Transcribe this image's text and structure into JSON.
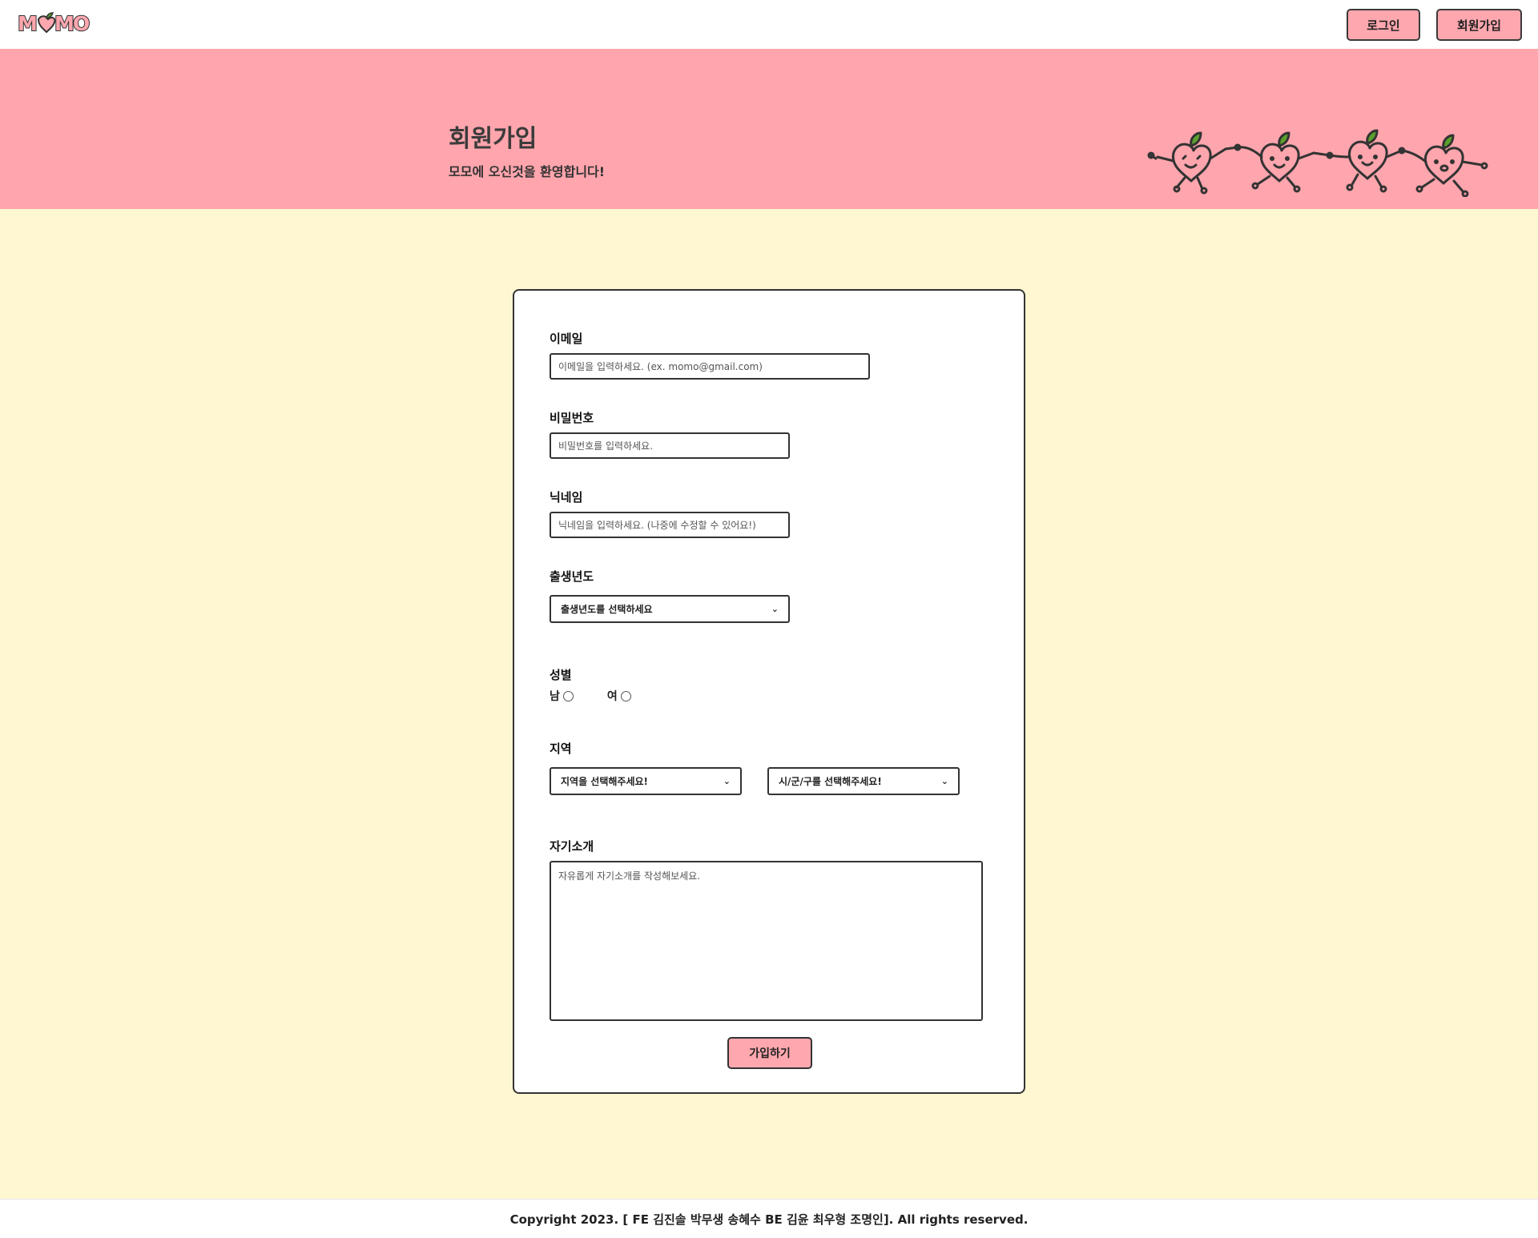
{
  "header": {
    "logo_text": "MOMO",
    "login_label": "로그인",
    "signup_label": "회원가입"
  },
  "banner": {
    "title": "회원가입",
    "subtitle": "모모에 오신것을 환영합니다!"
  },
  "form": {
    "email": {
      "label": "이메일",
      "placeholder": "이메일을 입력하세요. (ex. momo@gmail.com)"
    },
    "password": {
      "label": "비밀번호",
      "placeholder": "비밀번호를 입력하세요."
    },
    "nickname": {
      "label": "닉네임",
      "placeholder": "닉네임을 입력하세요. (나중에 수정할 수 있어요!)"
    },
    "birth_year": {
      "label": "출생년도",
      "selected": "출생년도를 선택하세요"
    },
    "gender": {
      "label": "성별",
      "options": [
        "남",
        "여"
      ]
    },
    "region": {
      "label": "지역",
      "province_selected": "지역을 선택해주세요!",
      "district_selected": "시/군/구를 선택해주세요!"
    },
    "intro": {
      "label": "자기소개",
      "placeholder": "자유롭게 자기소개를 작성해보세요."
    },
    "submit_label": "가입하기"
  },
  "footer": {
    "copyright": "Copyright 2023. [ FE 김진솔 박무생 송혜수 BE 김윤 최우형 조명인]. All rights reserved."
  },
  "colors": {
    "banner_bg": "#ffa5ad",
    "page_bg": "#fff7d1",
    "button_bg": "#ffa7ae",
    "border": "#333333"
  },
  "icons": {
    "logo_peach": "peach-icon",
    "select_arrow": "chevron-down-icon",
    "banner_art": "dancing-peaches-illustration"
  }
}
